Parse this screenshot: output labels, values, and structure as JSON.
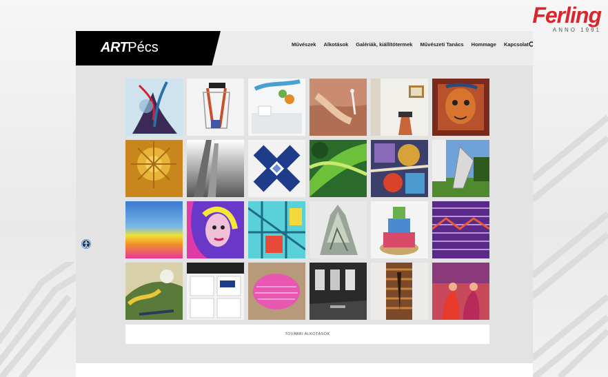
{
  "brand": {
    "name": "Ferling",
    "tagline": "ANNO 1991"
  },
  "site": {
    "logo_art": "ART",
    "logo_pecs": "Pécs",
    "nav": [
      {
        "label": "Művészek"
      },
      {
        "label": "Alkotások"
      },
      {
        "label": "Galériák, kiállítótermek"
      },
      {
        "label": "Művészeti Tanács"
      },
      {
        "label": "Hommage"
      },
      {
        "label": "Kapcsolat"
      }
    ],
    "more_button": "TOVÁBBI ALKOTÁSOK"
  },
  "gallery": {
    "rows": 4,
    "cols": 6,
    "artworks": [
      "abstract-blue-tree-painting",
      "red-frame-sculpture",
      "gallery-floral-installation",
      "reclining-figure-heron-painting",
      "exhibition-room-still-life",
      "red-face-portrait",
      "golden-sun-relief",
      "metal-fold-sculpture",
      "blue-cross-op-art",
      "green-abstract-painting",
      "colorful-geometric-collage",
      "outdoor-steel-sculpture",
      "rainbow-gradient-painting",
      "pop-art-portrait",
      "cyan-architecture-collage",
      "crumpled-glass-sculpture",
      "ribbon-tower-sculpture",
      "purple-woven-pattern",
      "expressive-landscape-painting",
      "print-layout-design",
      "pink-cushion-object",
      "dark-exhibition-hall",
      "wooden-ladder-sculpture",
      "red-figures-painting"
    ]
  },
  "colors": {
    "accent": "#d8262e",
    "header_bg": "#000000",
    "access": "#1d3b6e"
  }
}
